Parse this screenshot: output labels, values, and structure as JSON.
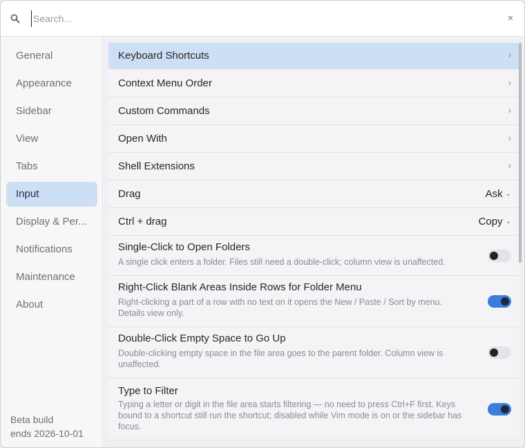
{
  "search": {
    "placeholder": "Search...",
    "value": "",
    "close_label": "×"
  },
  "sidebar": {
    "items": [
      {
        "label": "General"
      },
      {
        "label": "Appearance"
      },
      {
        "label": "Sidebar"
      },
      {
        "label": "View"
      },
      {
        "label": "Tabs"
      },
      {
        "label": "Input",
        "active": true
      },
      {
        "label": "Display & Per..."
      },
      {
        "label": "Notifications"
      },
      {
        "label": "Maintenance"
      },
      {
        "label": "About"
      }
    ],
    "beta_line1": "Beta build",
    "beta_line2": "ends 2026-10-01"
  },
  "settings": {
    "keyboard_shortcuts": "Keyboard Shortcuts",
    "context_menu_order": "Context Menu Order",
    "custom_commands": "Custom Commands",
    "open_with": "Open With",
    "shell_extensions": "Shell Extensions",
    "drag_label": "Drag",
    "drag_value": "Ask",
    "ctrl_drag_label": "Ctrl + drag",
    "ctrl_drag_value": "Copy",
    "single_click_title": "Single-Click to Open Folders",
    "single_click_desc": "A single click enters a folder. Files still need a double-click; column view is unaffected.",
    "single_click_enabled": false,
    "right_click_title": "Right-Click Blank Areas Inside Rows for Folder Menu",
    "right_click_desc": "Right-clicking a part of a row with no text on it opens the New / Paste / Sort by menu. Details view only.",
    "right_click_enabled": true,
    "double_click_title": "Double-Click Empty Space to Go Up",
    "double_click_desc": "Double-clicking empty space in the file area goes to the parent folder. Column view is unaffected.",
    "double_click_enabled": false,
    "type_filter_title": "Type to Filter",
    "type_filter_desc": "Typing a letter or digit in the file area starts filtering — no need to press Ctrl+F first. Keys bound to a shortcut still run the shortcut; disabled while Vim mode is on or the sidebar has focus.",
    "type_filter_enabled": true
  },
  "glyphs": {
    "chevron": "›",
    "caret": "⌄"
  },
  "colors": {
    "accent": "#3b7dd8",
    "selected": "#cddff4"
  }
}
